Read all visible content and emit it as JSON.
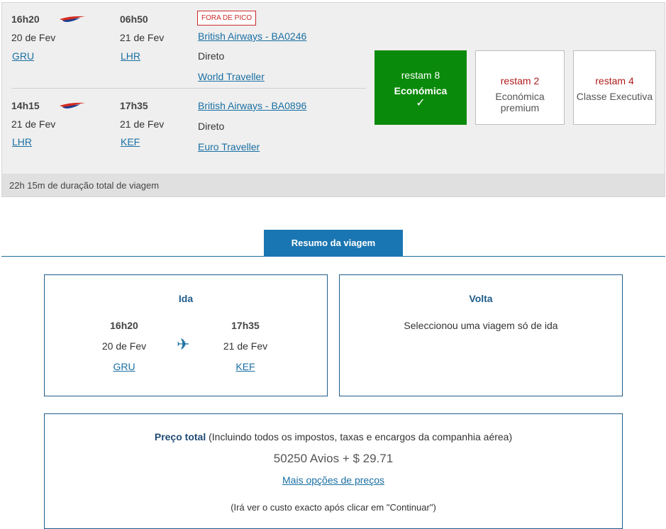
{
  "segments": [
    {
      "dep_time": "16h20",
      "dep_date": "20 de Fev",
      "dep_airport": "GRU",
      "arr_time": "06h50",
      "arr_date": "21 de Fev",
      "arr_airport": "LHR",
      "badge": "FORA DE PICO",
      "flight": "British Airways - BA0246",
      "stops": "Direto",
      "cabin_brand": "World Traveller"
    },
    {
      "dep_time": "14h15",
      "dep_date": "21 de Fev",
      "dep_airport": "LHR",
      "arr_time": "17h35",
      "arr_date": "21 de Fev",
      "arr_airport": "KEF",
      "flight": "British Airways - BA0896",
      "stops": "Direto",
      "cabin_brand": "Euro Traveller"
    }
  ],
  "cabins": [
    {
      "remaining": "restam 8",
      "name": "Económica",
      "selected": true
    },
    {
      "remaining": "restam 2",
      "name": "Económica premium",
      "selected": false
    },
    {
      "remaining": "restam 4",
      "name": "Classe Executiva",
      "selected": false
    }
  ],
  "duration": "22h 15m de duração total de viagem",
  "summary_tab": "Resumo da viagem",
  "outbound": {
    "title": "Ida",
    "dep_time": "16h20",
    "dep_date": "20 de Fev",
    "dep_airport": "GRU",
    "arr_time": "17h35",
    "arr_date": "21 de Fev",
    "arr_airport": "KEF"
  },
  "return": {
    "title": "Volta",
    "message": "Seleccionou uma viagem só de ida"
  },
  "price": {
    "label": "Preço total",
    "note": "(Incluindo todos os impostos, taxas e encargos da companhia aérea)",
    "amount": "50250 Avios + $ 29.71",
    "more_options": "Mais opções de preços",
    "disclaimer": "(Irá ver o custo exacto após clicar em \"Continuar\")"
  },
  "colors": {
    "selected_cabin": "#0a8a0a",
    "accent_blue": "#1a76b2",
    "link": "#1a6fa3",
    "remaining_red": "#b01c1c"
  },
  "icons": {
    "airline_logo": "british-airways-speedmarque-icon",
    "plane": "airplane-icon",
    "check": "checkmark-icon"
  }
}
